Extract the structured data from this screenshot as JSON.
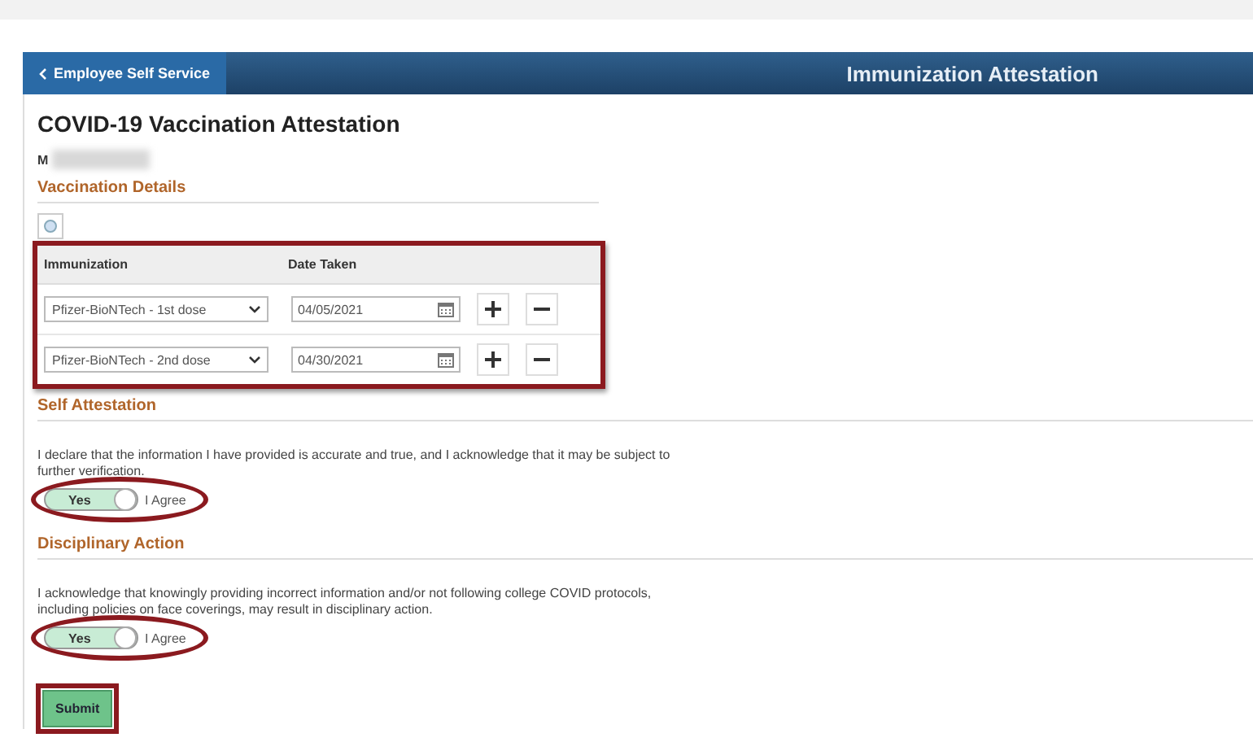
{
  "header": {
    "back_label": "Employee Self Service",
    "title": "Immunization Attestation"
  },
  "page_title": "COVID-19 Vaccination Attestation",
  "name_initial": "M",
  "vaccination": {
    "heading": "Vaccination Details",
    "highlighted": true,
    "columns": [
      "Immunization",
      "Date Taken"
    ],
    "rows": [
      {
        "immunization": "Pfizer-BioNTech - 1st dose",
        "date": "04/05/2021"
      },
      {
        "immunization": "Pfizer-BioNTech - 2nd dose",
        "date": "04/30/2021"
      }
    ]
  },
  "sections": [
    {
      "heading": "Self Attestation",
      "text": "I declare that the information I have provided is accurate and true, and I acknowledge that it may be subject to further verification.",
      "toggle": {
        "on_label": "Yes",
        "checked": true,
        "label": "I Agree",
        "highlighted": true
      }
    },
    {
      "heading": "Disciplinary Action",
      "text": "I acknowledge that knowingly providing incorrect information and/or not following college COVID protocols, including policies on face coverings, may result in disciplinary action.",
      "toggle": {
        "on_label": "Yes",
        "checked": true,
        "label": "I Agree",
        "highlighted": true
      }
    }
  ],
  "submit": {
    "label": "Submit",
    "highlighted": true
  }
}
